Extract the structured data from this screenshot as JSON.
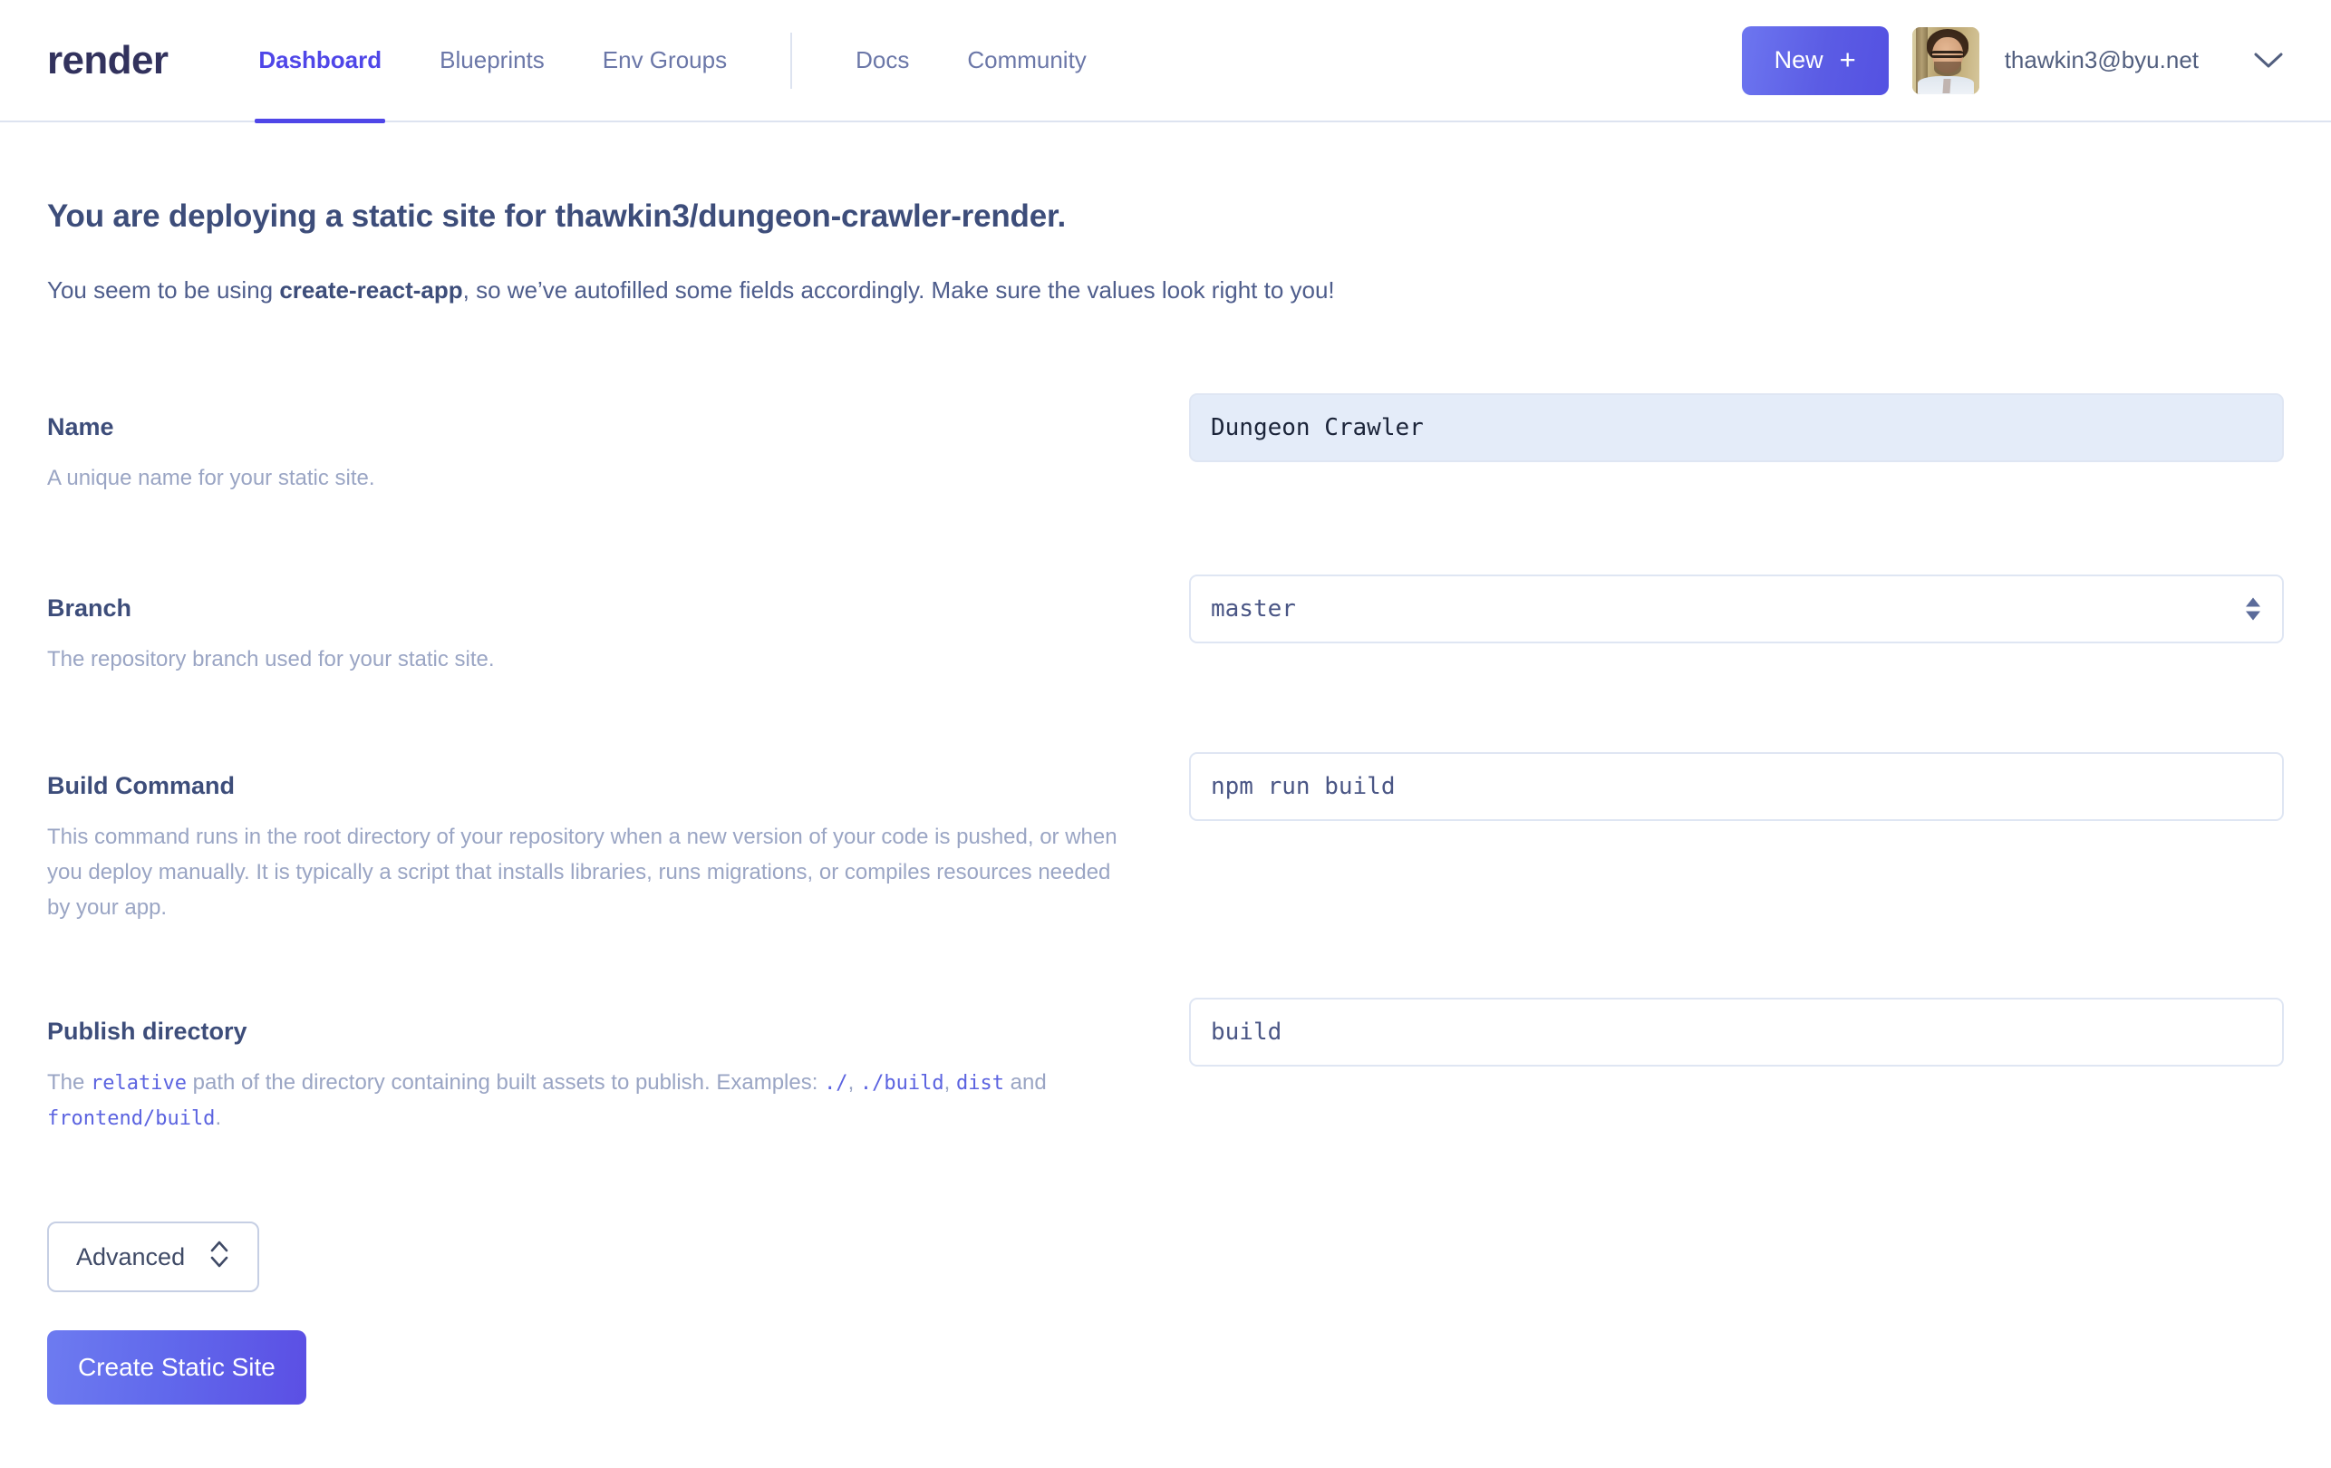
{
  "header": {
    "logo": "render",
    "nav_primary": [
      {
        "label": "Dashboard",
        "active": true
      },
      {
        "label": "Blueprints",
        "active": false
      },
      {
        "label": "Env Groups",
        "active": false
      }
    ],
    "nav_secondary": [
      {
        "label": "Docs"
      },
      {
        "label": "Community"
      }
    ],
    "new_button": {
      "label": "New",
      "plus": "+"
    },
    "user_email": "thawkin3@byu.net",
    "accent_color": "#4f46e8"
  },
  "page": {
    "title_prefix": "You are deploying a static site for",
    "title_repo": "thawkin3/dungeon-crawler-render.",
    "subtitle_before": "You seem to be using ",
    "subtitle_bold": "create-react-app",
    "subtitle_after": ", so we’ve autofilled some fields accordingly. Make sure the values look right to you!"
  },
  "fields": {
    "name": {
      "label": "Name",
      "help": "A unique name for your static site.",
      "value": "Dungeon Crawler",
      "placeholder": "Dungeon Crawler"
    },
    "branch": {
      "label": "Branch",
      "help": "The repository branch used for your static site.",
      "value": "master",
      "options": [
        "master"
      ]
    },
    "build_command": {
      "label": "Build Command",
      "help": "This command runs in the root directory of your repository when a new version of your code is pushed, or when you deploy manually. It is typically a script that installs libraries, runs migrations, or compiles resources needed by your app.",
      "value": "npm run build",
      "placeholder": "npm run build"
    },
    "publish_directory": {
      "label": "Publish directory",
      "help_1": "The ",
      "help_code_1": "relative",
      "help_2": " path of the directory containing built assets to publish. Examples: ",
      "help_code_2": "./",
      "help_sep_1": ", ",
      "help_code_3": "./build",
      "help_sep_2": ", ",
      "help_code_4": "dist",
      "help_3": " and ",
      "help_code_5": "frontend/build",
      "help_4": ".",
      "value": "build",
      "placeholder": "build"
    }
  },
  "actions": {
    "advanced_label": "Advanced",
    "create_label": "Create Static Site"
  }
}
